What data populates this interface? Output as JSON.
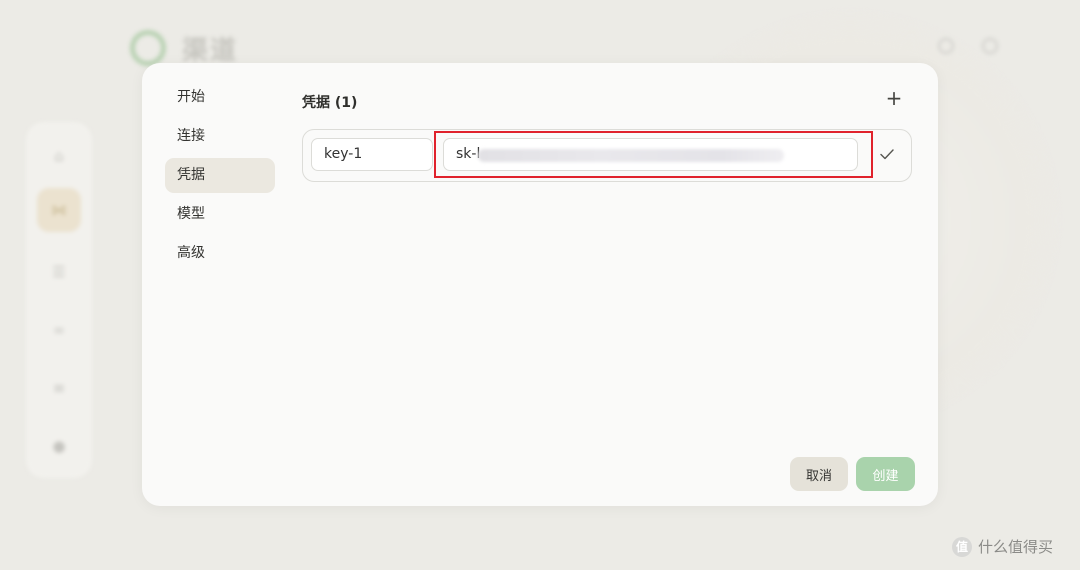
{
  "background": {
    "app_title": "渠道",
    "nav_icons": [
      "home-icon",
      "channel-icon",
      "chat-icon",
      "link-icon",
      "list-icon",
      "settings-icon"
    ]
  },
  "modal": {
    "nav": [
      "开始",
      "连接",
      "凭据",
      "模型",
      "高级"
    ],
    "active_nav": "凭据",
    "section_title": "凭据 (1)",
    "add_label": "+",
    "credential": {
      "name": "key-1",
      "key_visible_prefix": "sk-l"
    },
    "cancel_label": "取消",
    "create_label": "创建"
  },
  "watermark": {
    "badge": "值",
    "text": "什么值得买"
  },
  "colors": {
    "highlight": "#e0222c",
    "create_button": "#a9d3ac",
    "cancel_button": "#e5e2d9",
    "active_nav": "#ebe8e0"
  }
}
